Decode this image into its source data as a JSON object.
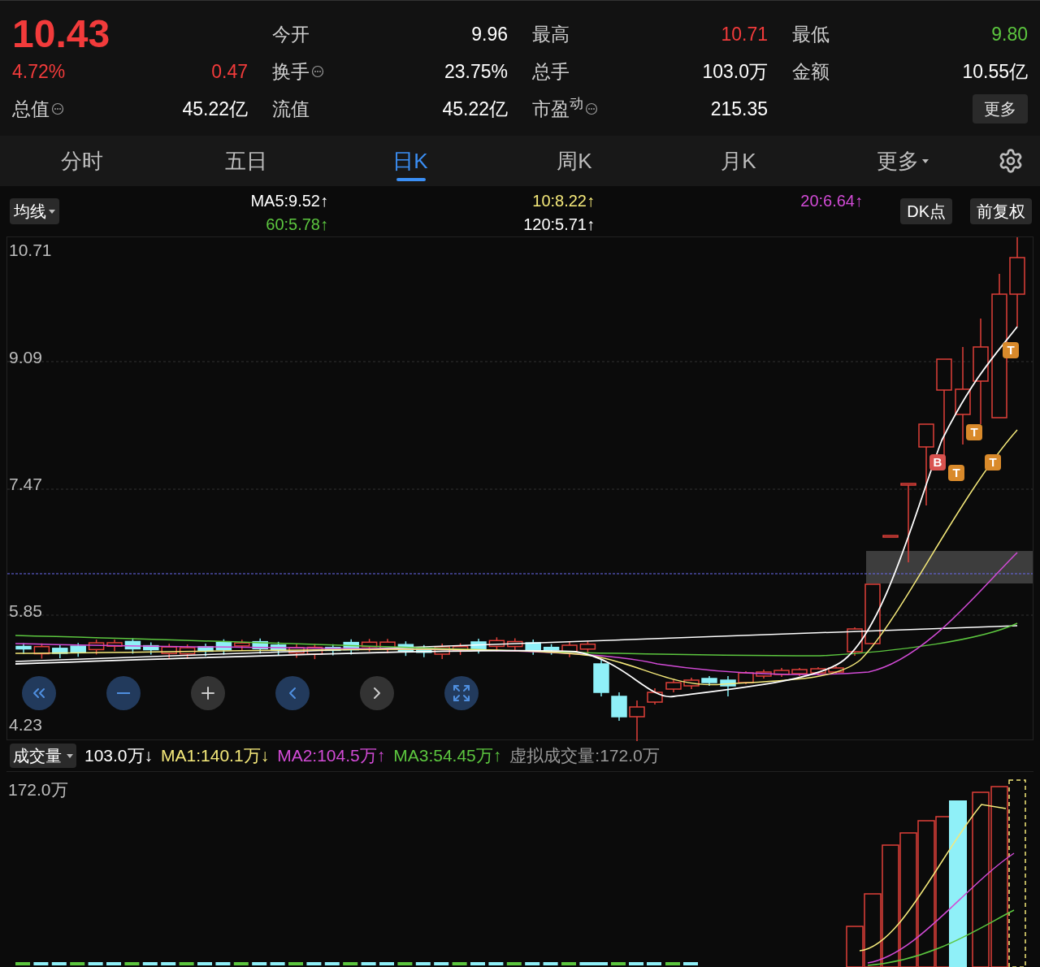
{
  "quote": {
    "price": "10.43",
    "change_pct": "4.72%",
    "change": "0.47",
    "color": "#f23b3b"
  },
  "stats": [
    {
      "label": "今开",
      "value": "9.96",
      "color": "#ffffff",
      "info": false
    },
    {
      "label": "最高",
      "value": "10.71",
      "color": "#f23b3b",
      "info": false
    },
    {
      "label": "最低",
      "value": "9.80",
      "color": "#5cc63f",
      "info": false
    },
    {
      "label": "换手",
      "value": "23.75%",
      "color": "#ffffff",
      "info": true
    },
    {
      "label": "总手",
      "value": "103.0万",
      "color": "#ffffff",
      "info": false
    },
    {
      "label": "金额",
      "value": "10.55亿",
      "color": "#ffffff",
      "info": false
    },
    {
      "label": "总值",
      "value": "45.22亿",
      "color": "#ffffff",
      "info": true
    },
    {
      "label": "流值",
      "value": "45.22亿",
      "color": "#ffffff",
      "info": false
    },
    {
      "label": "市盈$^{动}$",
      "value": "215.35",
      "color": "#ffffff",
      "info": true
    }
  ],
  "more_button": "更多",
  "tabs": [
    {
      "label": "分时",
      "selected": false,
      "kind": "tab"
    },
    {
      "label": "五日",
      "selected": false,
      "kind": "tab"
    },
    {
      "label": "日K",
      "selected": true,
      "kind": "tab"
    },
    {
      "label": "周K",
      "selected": false,
      "kind": "tab"
    },
    {
      "label": "月K",
      "selected": false,
      "kind": "tab"
    },
    {
      "label": "更多",
      "selected": false,
      "kind": "menu"
    }
  ],
  "indicator_dropdown": "均线",
  "ma_lines": [
    {
      "label": "MA5:9.52↑",
      "color": "#ffffff"
    },
    {
      "label": "60:5.78↑",
      "color": "#5cc63f"
    },
    {
      "label": "10:8.22↑",
      "color": "#f5e97a"
    },
    {
      "label": "120:5.71↑",
      "color": "#ffffff"
    },
    {
      "label": "20:6.64↑",
      "color": "#d24bd6"
    }
  ],
  "chart_buttons": [
    "DK点",
    "前复权"
  ],
  "y_labels": [
    "10.71",
    "9.09",
    "7.47",
    "5.85",
    "4.23"
  ],
  "markers": [
    {
      "label": "B",
      "kind": "buy"
    },
    {
      "label": "T",
      "kind": "t"
    },
    {
      "label": "T",
      "kind": "t"
    },
    {
      "label": "T",
      "kind": "t"
    },
    {
      "label": "T",
      "kind": "t"
    }
  ],
  "volume": {
    "dropdown": "成交量",
    "items": [
      {
        "label": "103.0万↓",
        "color": "#ffffff"
      },
      {
        "label": "MA1:140.1万↓",
        "color": "#f5e97a"
      },
      {
        "label": "MA2:104.5万↑",
        "color": "#d24bd6"
      },
      {
        "label": "MA3:54.45万↑",
        "color": "#5cc63f"
      },
      {
        "label": "虚拟成交量:172.0万",
        "color": "#9a9a9a"
      }
    ],
    "max_label": "172.0万"
  }
}
